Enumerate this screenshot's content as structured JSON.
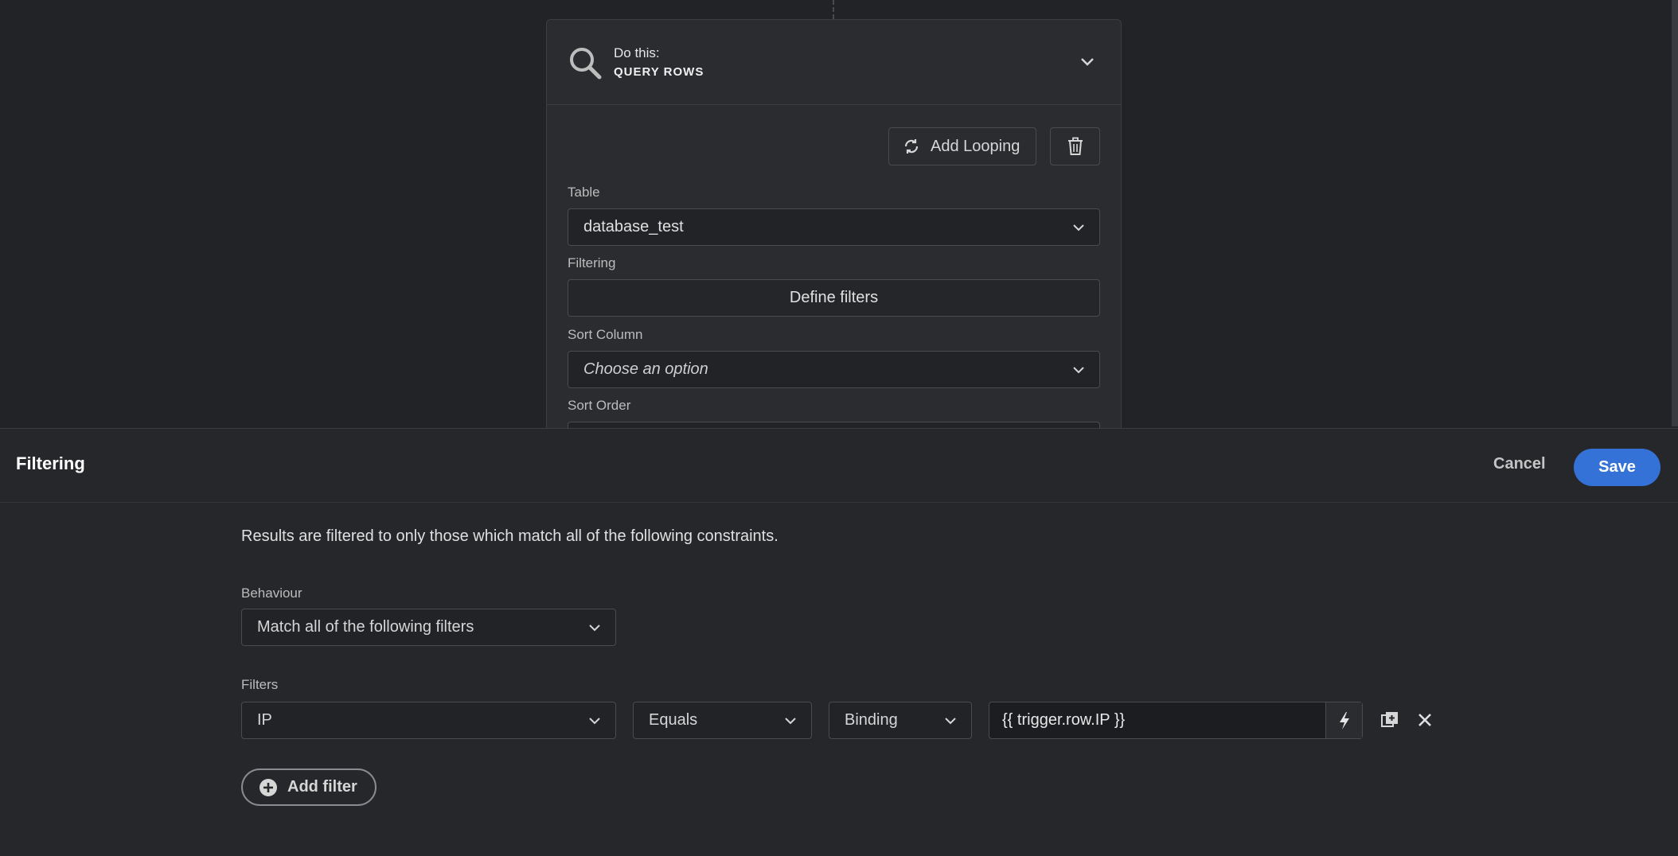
{
  "step": {
    "do_this_label": "Do this:",
    "action_name": "QUERY ROWS",
    "add_looping_label": "Add Looping",
    "fields": {
      "table_label": "Table",
      "table_value": "database_test",
      "filtering_label": "Filtering",
      "define_filters_label": "Define filters",
      "sort_column_label": "Sort Column",
      "sort_column_placeholder": "Choose an option",
      "sort_order_label": "Sort Order"
    }
  },
  "panel": {
    "title": "Filtering",
    "cancel_label": "Cancel",
    "save_label": "Save",
    "description": "Results are filtered to only those which match all of the following constraints.",
    "behaviour_label": "Behaviour",
    "behaviour_value": "Match all of the following filters",
    "filters_label": "Filters",
    "filter_row": {
      "field": "IP",
      "operator": "Equals",
      "value_type": "Binding",
      "value": "{{ trigger.row.IP }}"
    },
    "add_filter_label": "Add filter"
  },
  "colors": {
    "primary": "#3572d8",
    "background": "#222327",
    "panel": "#26272b"
  }
}
